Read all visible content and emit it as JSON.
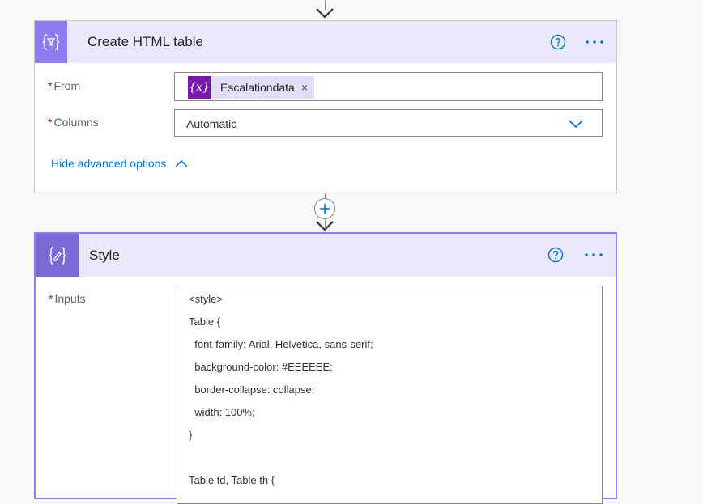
{
  "create_html_table": {
    "title": "Create HTML table",
    "from_label": "From",
    "from_token": "Escalationdata",
    "from_token_close": "×",
    "columns_label": "Columns",
    "columns_value": "Automatic",
    "advanced_toggle": "Hide advanced options"
  },
  "style_action": {
    "title": "Style",
    "inputs_label": "Inputs",
    "inputs_lines": [
      "<style>",
      "Table {",
      "  font-family: Arial, Helvetica, sans-serif;",
      "  background-color: #EEEEEE;",
      "  border-collapse: collapse;",
      "  width: 100%;",
      "}",
      "",
      "Table td, Table th {"
    ]
  },
  "required_marker": "*",
  "token_icon_text": "{x}",
  "colors": {
    "accent": "#0078d4",
    "card_header_bg": "#ebe7fc",
    "card_icon_bg": "#8e7cf0",
    "token_bg": "#e3ddf7",
    "token_icon_bg": "#7719aa",
    "selected_border": "#8e7cf0",
    "required": "#a4262c"
  },
  "icons": {
    "create_html_table": "data-operation-icon",
    "style": "compose-icon",
    "help": "help-icon",
    "more": "more-options-icon",
    "add_step": "plus-icon"
  }
}
